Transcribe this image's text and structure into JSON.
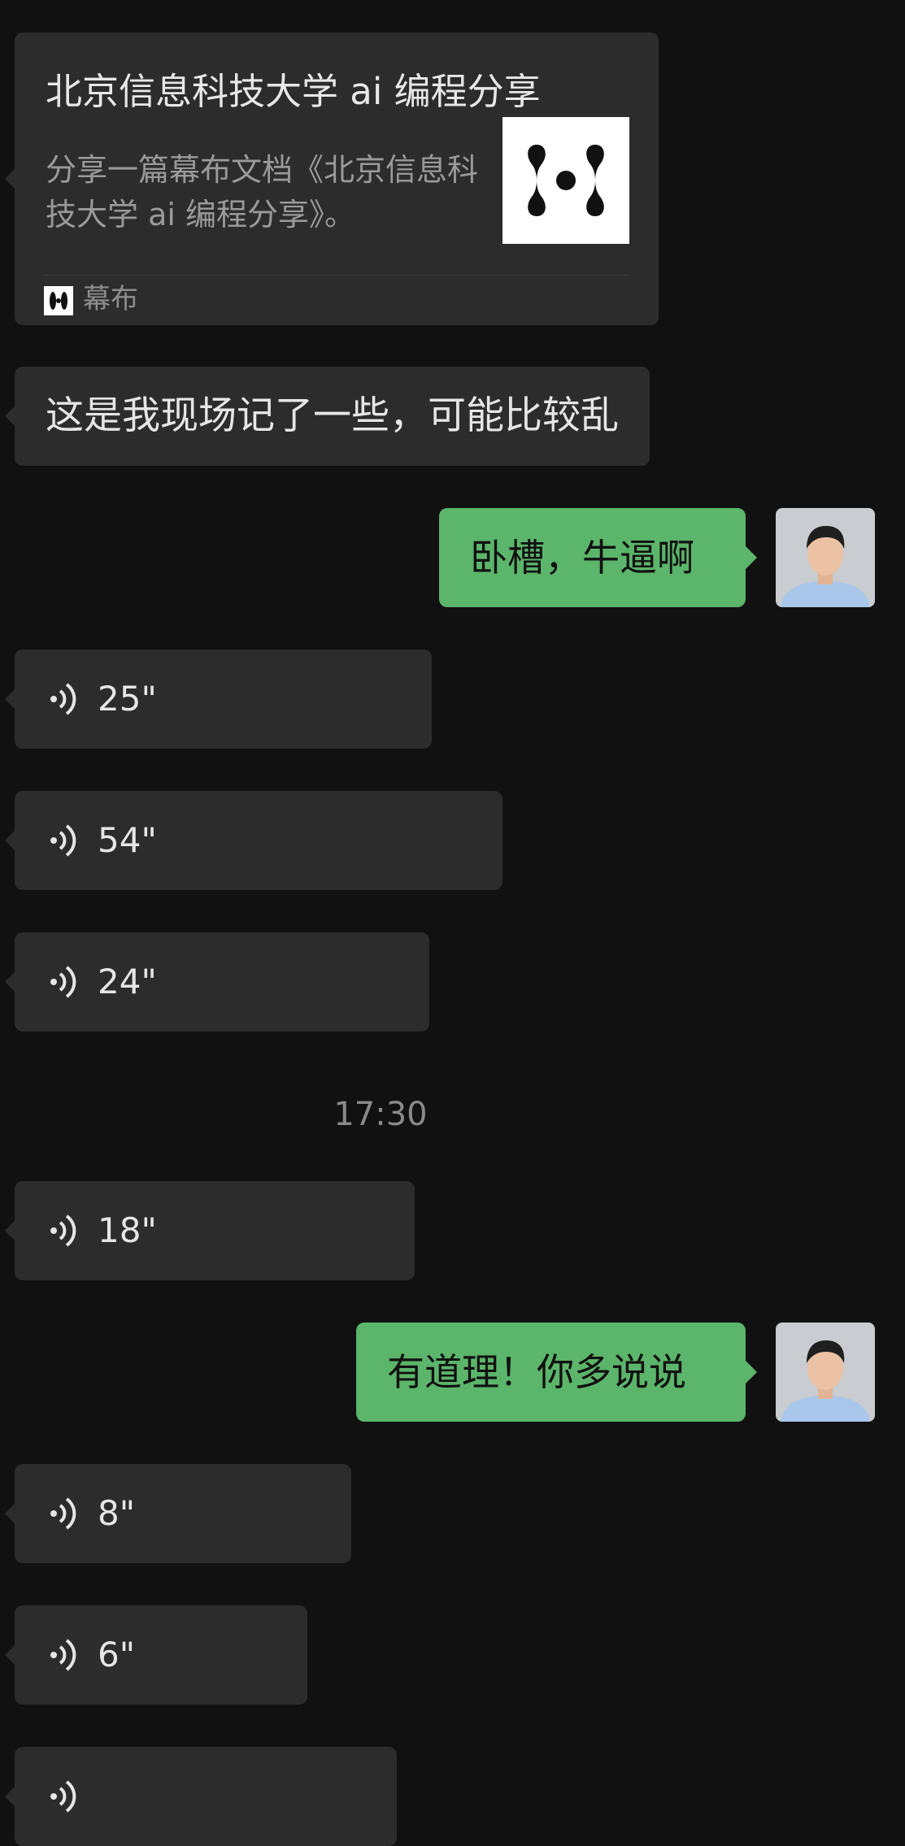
{
  "colors": {
    "background": "#111111",
    "incoming_bubble": "#2c2c2c",
    "outgoing_bubble": "#5bb56a"
  },
  "share_card": {
    "title": "北京信息科技大学 ai 编程分享",
    "description": "分享一篇幕布文档《北京信息科技大学 ai 编程分享》。",
    "source": "幕布",
    "thumbnail_icon": "mubu-logo-icon"
  },
  "messages": {
    "m1_text": "这是我现场记了一些，可能比较乱",
    "m2_text": "卧槽，牛逼啊",
    "v1_duration": "25\"",
    "v2_duration": "54\"",
    "v3_duration": "24\"",
    "timestamp": "17:30",
    "v4_duration": "18\"",
    "m3_text": "有道理！你多说说",
    "v5_duration": "8\"",
    "v6_duration": "6\"",
    "v7_duration": ""
  }
}
